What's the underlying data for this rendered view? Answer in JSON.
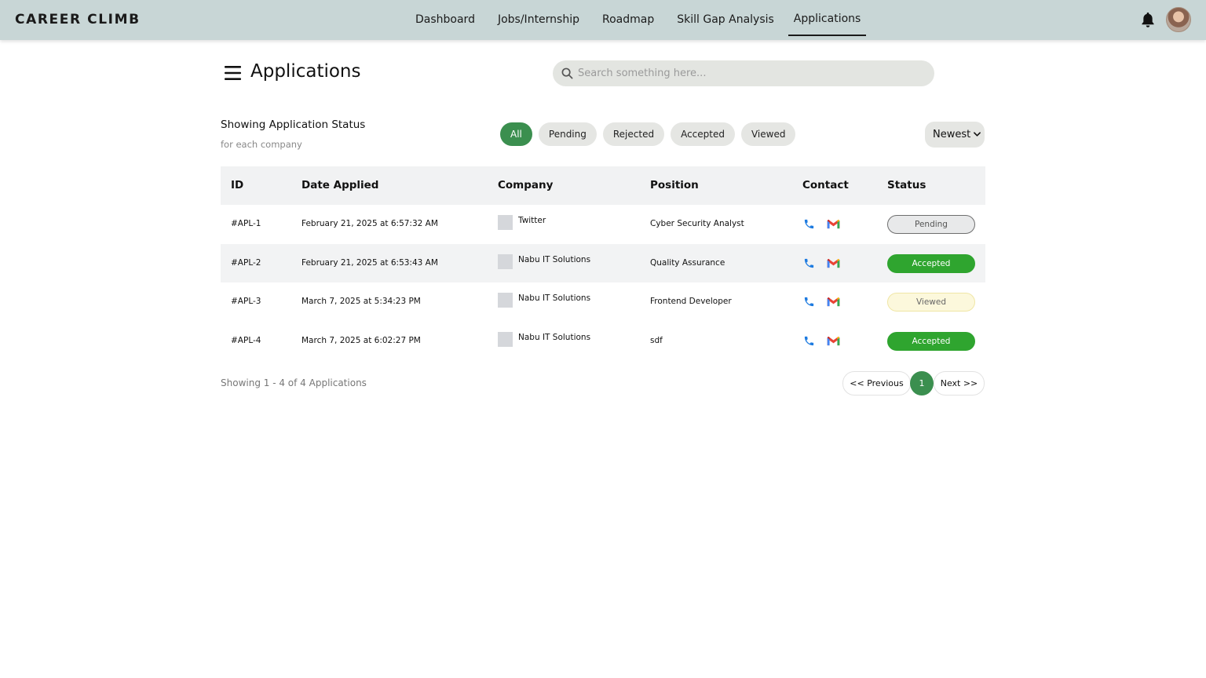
{
  "brand": "CAREER CLIMB",
  "nav": {
    "items": [
      {
        "label": "Dashboard"
      },
      {
        "label": "Jobs/Internship"
      },
      {
        "label": "Roadmap"
      },
      {
        "label": "Skill Gap Analysis"
      },
      {
        "label": "Applications",
        "active": true
      }
    ]
  },
  "page": {
    "title": "Applications"
  },
  "search": {
    "placeholder": "Search something here..."
  },
  "status_header": {
    "title": "Showing Application Status",
    "subtitle": "for each company"
  },
  "filters": [
    {
      "label": "All",
      "active": true
    },
    {
      "label": "Pending"
    },
    {
      "label": "Rejected"
    },
    {
      "label": "Accepted"
    },
    {
      "label": "Viewed"
    }
  ],
  "sort": {
    "selected": "Newest"
  },
  "table": {
    "headers": {
      "id": "ID",
      "date": "Date Applied",
      "company": "Company",
      "position": "Position",
      "contact": "Contact",
      "status": "Status"
    },
    "rows": [
      {
        "id": "#APL-1",
        "date": "February 21, 2025 at 6:57:32 AM",
        "company": "Twitter",
        "position": "Cyber Security Analyst",
        "status": "Pending"
      },
      {
        "id": "#APL-2",
        "date": "February 21, 2025 at 6:53:43 AM",
        "company": "Nabu IT Solutions",
        "position": "Quality Assurance",
        "status": "Accepted"
      },
      {
        "id": "#APL-3",
        "date": "March 7, 2025 at 5:34:23 PM",
        "company": "Nabu IT Solutions",
        "position": "Frontend Developer",
        "status": "Viewed"
      },
      {
        "id": "#APL-4",
        "date": "March 7, 2025 at 6:02:27 PM",
        "company": "Nabu IT Solutions",
        "position": "sdf",
        "status": "Accepted"
      }
    ]
  },
  "footer": {
    "showing": "Showing 1 - 4 of 4 Applications",
    "prev": "<< Previous",
    "page": "1",
    "next": "Next >>"
  },
  "colors": {
    "navbar": "#c8d6d6",
    "accent_green": "#3b8f4f",
    "accepted": "#2fa52f",
    "viewed": "#fcf8dc",
    "phone": "#1e7be0"
  },
  "icons": [
    "bell-icon",
    "avatar",
    "menu-icon",
    "search-icon",
    "chevron-down-icon",
    "phone-icon",
    "gmail-icon"
  ]
}
